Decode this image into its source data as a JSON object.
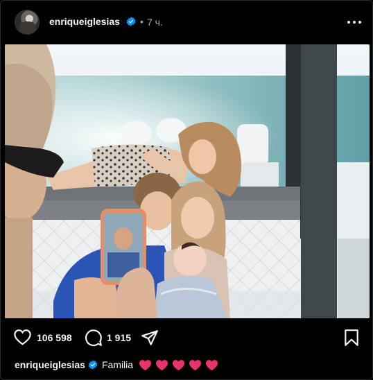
{
  "post": {
    "username": "enriqueiglesias",
    "verified": true,
    "separator": "•",
    "time_ago": "7 ч.",
    "more_icon": "more-horizontal-icon"
  },
  "media": {
    "type": "photo"
  },
  "actions": {
    "like_icon": "heart-outline-icon",
    "like_count": "106 598",
    "comment_icon": "comment-bubble-icon",
    "comment_count": "1 915",
    "share_icon": "paper-plane-icon",
    "save_icon": "bookmark-icon"
  },
  "caption": {
    "username": "enriqueiglesias",
    "text": "Familia",
    "emoji": [
      "heart",
      "heart",
      "heart",
      "heart",
      "heart"
    ],
    "emoji_color": "#e8336b"
  },
  "colors": {
    "background": "#000000",
    "text": "#f5f5f5",
    "muted": "#a8a8a8",
    "verified": "#0095f6"
  }
}
